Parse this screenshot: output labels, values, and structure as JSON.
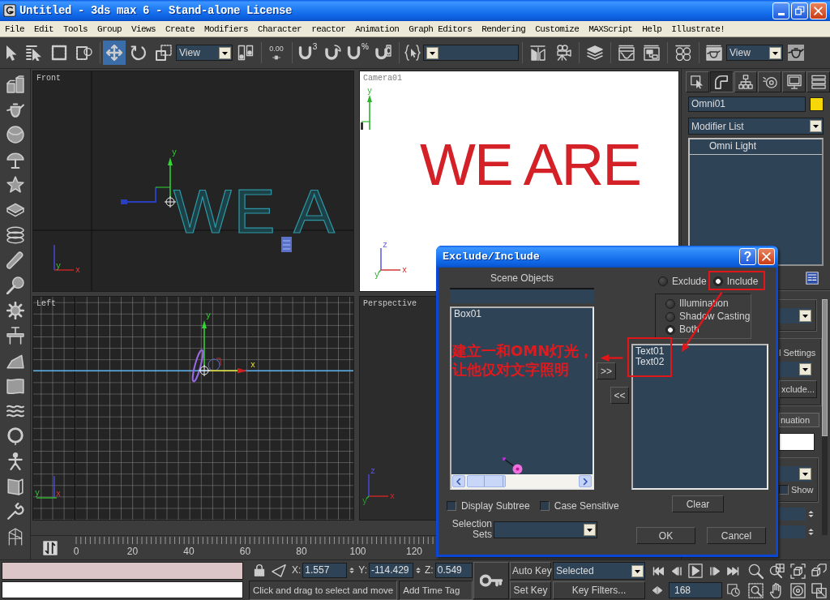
{
  "window": {
    "title": "Untitled - 3ds max 6 - Stand-alone License"
  },
  "menu": [
    {
      "label": "File"
    },
    {
      "label": "Edit"
    },
    {
      "label": "Tools"
    },
    {
      "label": "Group"
    },
    {
      "label": "Views"
    },
    {
      "label": "Create"
    },
    {
      "label": "Modifiers"
    },
    {
      "label": "Character"
    },
    {
      "label": "reactor"
    },
    {
      "label": "Animation"
    },
    {
      "label": "Graph Editors"
    },
    {
      "label": "Rendering"
    },
    {
      "label": "Customize"
    },
    {
      "label": "MAXScript"
    },
    {
      "label": "Help"
    },
    {
      "label": "Illustrate!"
    }
  ],
  "main_toolbar": [
    {
      "kind": "select",
      "selected": false
    },
    {
      "kind": "select-by-name",
      "selected": false
    },
    {
      "kind": "region",
      "selected": false
    },
    {
      "kind": "window-crossing",
      "selected": false
    },
    {
      "kind": "separator"
    },
    {
      "kind": "move",
      "selected": true
    },
    {
      "kind": "rotate",
      "selected": false
    },
    {
      "kind": "scale",
      "selected": false
    },
    {
      "kind": "view-dropdown",
      "value": "View"
    },
    {
      "kind": "pivot",
      "selected": false
    },
    {
      "kind": "separator"
    },
    {
      "kind": "spinner-snap",
      "label": "0.00",
      "selected": false
    },
    {
      "kind": "separator"
    },
    {
      "kind": "snap",
      "label": "3",
      "selected": false
    },
    {
      "kind": "angle-snap",
      "selected": false
    },
    {
      "kind": "percent-snap",
      "label": "%",
      "selected": false
    },
    {
      "kind": "spinner-toggle",
      "selected": false
    },
    {
      "kind": "separator"
    },
    {
      "kind": "named-selection",
      "selected": false
    },
    {
      "kind": "selection-dropdown"
    },
    {
      "kind": "separator"
    },
    {
      "kind": "mirror",
      "selected": false
    },
    {
      "kind": "align",
      "selected": false
    },
    {
      "kind": "separator"
    },
    {
      "kind": "layers",
      "selected": false
    },
    {
      "kind": "separator"
    },
    {
      "kind": "curve-editor",
      "selected": false
    },
    {
      "kind": "schematic",
      "selected": false
    },
    {
      "kind": "separator"
    },
    {
      "kind": "material-editor",
      "selected": false
    },
    {
      "kind": "separator"
    },
    {
      "kind": "render-scene",
      "selected": false
    },
    {
      "kind": "view-dropdown",
      "value": "View"
    },
    {
      "kind": "quick-render",
      "selected": false
    }
  ],
  "left_toolbar": [
    {
      "kind": "blocks"
    },
    {
      "kind": "teapot"
    },
    {
      "kind": "sphere"
    },
    {
      "kind": "umbrella"
    },
    {
      "kind": "star"
    },
    {
      "kind": "plane"
    },
    {
      "kind": "rings"
    },
    {
      "kind": "rod"
    },
    {
      "kind": "pin"
    },
    {
      "kind": "gear"
    },
    {
      "kind": "hinge"
    },
    {
      "kind": "wedge"
    },
    {
      "kind": "cloth"
    },
    {
      "kind": "wave"
    },
    {
      "kind": "loop"
    },
    {
      "kind": "figure"
    },
    {
      "kind": "panel"
    },
    {
      "kind": "tool"
    },
    {
      "kind": "wire-figure"
    }
  ],
  "viewports": [
    {
      "label": "Front",
      "kind": "front",
      "scene_text": "WE A",
      "gizmo_labels": [
        "y"
      ],
      "tripod_labels": {
        "origin": "y",
        "right": "x"
      }
    },
    {
      "label": "Camera01",
      "kind": "camera",
      "scene_text": "WE ARE",
      "gizmo_labels": [
        "y"
      ],
      "tripod_labels": {
        "top": "z",
        "origin": "y",
        "right": "x"
      }
    },
    {
      "label": "Left",
      "kind": "left",
      "gizmo_labels": [
        "y",
        "x"
      ],
      "tripod_labels": {
        "left": "y",
        "origin": "x"
      }
    },
    {
      "label": "Perspective",
      "kind": "perspective",
      "tripod_labels": {
        "top": "z",
        "origin": "y",
        "right": "x"
      }
    }
  ],
  "track_bar": {
    "ticks": [
      "0",
      "20",
      "40",
      "60",
      "80",
      "100",
      "120"
    ]
  },
  "command_panel": {
    "tabs": [
      {
        "kind": "create",
        "selected": false
      },
      {
        "kind": "modify",
        "selected": true
      },
      {
        "kind": "hierarchy",
        "selected": false
      },
      {
        "kind": "motion",
        "selected": false
      },
      {
        "kind": "display",
        "selected": false
      },
      {
        "kind": "utilities",
        "selected": false
      }
    ],
    "object_name": "Omni01",
    "modifier_list": "Modifier List",
    "stack": [
      {
        "label": "Omni Light",
        "selected": false
      }
    ],
    "rollouts": [
      {
        "kind": "group",
        "items": [
          {
            "kind": "dropdown"
          }
        ]
      },
      {
        "kind": "group",
        "items": [
          {
            "kind": "label",
            "text": "l Settings"
          },
          {
            "kind": "dropdown"
          },
          {
            "kind": "button",
            "text": "xclude..."
          }
        ]
      },
      {
        "kind": "header",
        "text": "nuation"
      },
      {
        "kind": "swatch"
      },
      {
        "kind": "group",
        "items": [
          {
            "kind": "dropdown"
          },
          {
            "kind": "checkbox",
            "text": "Show",
            "checked": false
          }
        ]
      },
      {
        "kind": "spinner"
      },
      {
        "kind": "spinner"
      }
    ]
  },
  "status_bar": {
    "coordinates": [
      {
        "label": "X:",
        "value": "1.557"
      },
      {
        "label": "Y:",
        "value": "-114.429"
      },
      {
        "label": "Z:",
        "value": "0.549"
      }
    ],
    "prompt": "Click and drag to select and move",
    "time_tag": "Add Time Tag",
    "auto_key": {
      "label": "Auto Key",
      "on": false
    },
    "set_key": "Set Key",
    "key_selection": "Selected",
    "key_filters": "Key Filters...",
    "current_frame": "168"
  },
  "dialog": {
    "title": "Exclude/Include",
    "help": "?",
    "scene_objects_label": "Scene Objects",
    "scene_objects": [
      {
        "label": "Box01",
        "selected": false
      }
    ],
    "mode_options": [
      {
        "label": "Exclude",
        "selected": false
      },
      {
        "label": "Include",
        "selected": true
      }
    ],
    "affect_options": [
      {
        "label": "Illumination",
        "selected": false
      },
      {
        "label": "Shadow Casting",
        "selected": false
      },
      {
        "label": "Both",
        "selected": true
      }
    ],
    "add_button": ">>",
    "remove_button": "<<",
    "included_objects": [
      {
        "label": "Text01",
        "selected": false
      },
      {
        "label": "Text02",
        "selected": false
      }
    ],
    "clear_button": "Clear",
    "options": [
      {
        "label": "Display Subtree",
        "checked": false
      },
      {
        "label": "Case Sensitive",
        "checked": false
      }
    ],
    "selection_sets_label": "Selection Sets",
    "buttons": [
      "OK",
      "Cancel"
    ]
  },
  "annotation": {
    "lines": [
      "建立一和OMN灯光，",
      "让他仅对文字照明"
    ]
  }
}
